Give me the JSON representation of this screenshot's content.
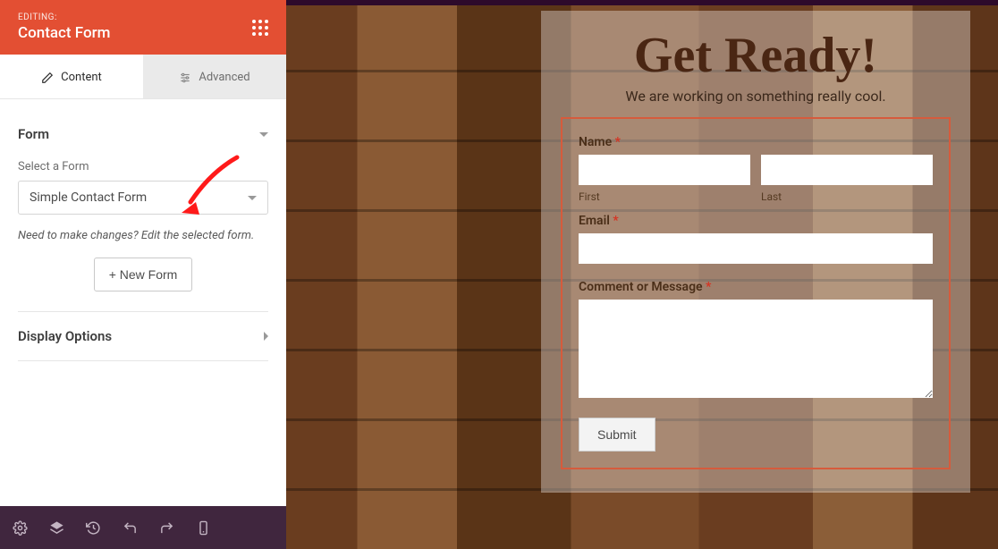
{
  "sidebar": {
    "editing_label": "EDITING:",
    "widget_title": "Contact Form",
    "tabs": {
      "content": "Content",
      "advanced": "Advanced"
    },
    "form_section": {
      "title": "Form",
      "select_label": "Select a Form",
      "selected_form": "Simple Contact Form",
      "help_text": "Need to make changes? Edit the selected form.",
      "new_form_btn": "+ New Form"
    },
    "display_section": {
      "title": "Display Options"
    }
  },
  "bottom_icons": [
    "gear-icon",
    "layers-icon",
    "history-icon",
    "undo-icon",
    "redo-icon",
    "mobile-icon"
  ],
  "preview": {
    "title": "Get Ready!",
    "subtitle": "We are working on something really cool.",
    "form": {
      "name_label": "Name",
      "first_sub": "First",
      "last_sub": "Last",
      "email_label": "Email",
      "comment_label": "Comment or Message",
      "submit": "Submit",
      "required_mark": "*"
    }
  },
  "colors": {
    "header_bg": "#e34f33",
    "bottom_bg": "#40263e",
    "form_border": "#d65b3c"
  }
}
